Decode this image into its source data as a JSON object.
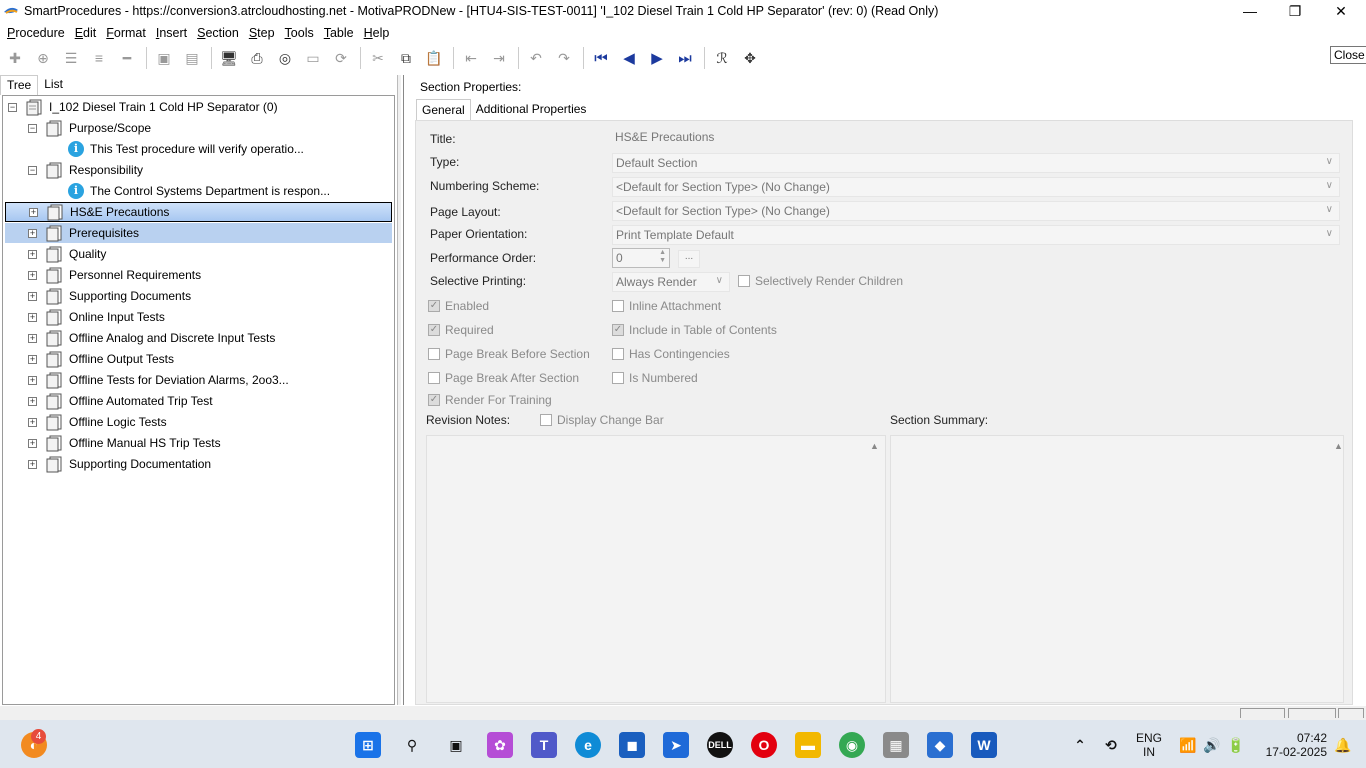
{
  "window": {
    "title": "SmartProcedures - https://conversion3.atrcloudhosting.net - MotivaPRODNew - [HTU4-SIS-TEST-0011] 'I_102 Diesel Train 1 Cold HP Separator' (rev: 0) (Read Only)",
    "min_glyph": "—",
    "max_glyph": "❐",
    "close_glyph": "✕",
    "close_tooltip": "Close"
  },
  "menu": [
    "Procedure",
    "Edit",
    "Format",
    "Insert",
    "Section",
    "Step",
    "Tools",
    "Table",
    "Help"
  ],
  "toolbar": {
    "first": "⏮",
    "prev": "◀",
    "next": "▶",
    "last": "⏭"
  },
  "left_tabs": [
    "Tree",
    "List"
  ],
  "tree": {
    "root": "I_102 Diesel Train 1 Cold HP Separator (0)",
    "expand_glyph": "+",
    "collapse_glyph": "−",
    "info_glyph": "i",
    "items": [
      {
        "label": "Purpose/Scope",
        "child": "This Test procedure will verify operatio..."
      },
      {
        "label": "Responsibility",
        "child": "The Control Systems Department is respon..."
      },
      {
        "label": "HS&E Precautions"
      },
      {
        "label": "Prerequisites"
      },
      {
        "label": "Quality"
      },
      {
        "label": "Personnel Requirements"
      },
      {
        "label": "Supporting Documents"
      },
      {
        "label": "Online Input Tests"
      },
      {
        "label": "Offline Analog and Discrete Input Tests"
      },
      {
        "label": "Offline Output Tests"
      },
      {
        "label": "Offline Tests for Deviation Alarms, 2oo3..."
      },
      {
        "label": "Offline Automated Trip Test"
      },
      {
        "label": "Offline Logic Tests"
      },
      {
        "label": "Offline Manual HS Trip Tests"
      },
      {
        "label": "Supporting Documentation"
      }
    ]
  },
  "props": {
    "header": "Section Properties:",
    "tabs": [
      "General",
      "Additional Properties"
    ],
    "title_label": "Title:",
    "title_value": "HS&E Precautions",
    "type_label": "Type:",
    "type_value": "Default Section",
    "numbering_label": "Numbering Scheme:",
    "numbering_value": "<Default for Section Type> (No Change)",
    "layout_label": "Page Layout:",
    "layout_value": "<Default for Section Type> (No Change)",
    "orientation_label": "Paper Orientation:",
    "orientation_value": "Print Template Default",
    "perf_label": "Performance Order:",
    "perf_value": "0",
    "perf_button": "...",
    "selective_label": "Selective Printing:",
    "selective_value": "Always Render",
    "selective_children": "Selectively Render Children",
    "checkboxes_left": [
      {
        "label": "Enabled",
        "checked": true
      },
      {
        "label": "Required",
        "checked": true
      },
      {
        "label": "Page Break Before Section",
        "checked": false
      },
      {
        "label": "Page Break After Section",
        "checked": false
      },
      {
        "label": "Render For Training",
        "checked": true
      }
    ],
    "checkboxes_right": [
      {
        "label": "Inline Attachment",
        "checked": false
      },
      {
        "label": "Include in Table of Contents",
        "checked": true
      },
      {
        "label": "Has Contingencies",
        "checked": false
      },
      {
        "label": "Is Numbered",
        "checked": false
      }
    ],
    "revision_label": "Revision Notes:",
    "change_bar": "Display Change Bar",
    "summary_label": "Section Summary:",
    "chev": "∨",
    "check_glyph": "✓",
    "up_glyph": "▲"
  },
  "taskbar": {
    "badge": "4",
    "lang": "ENG",
    "region": "IN",
    "time": "07:42",
    "date": "17-02-2025"
  }
}
